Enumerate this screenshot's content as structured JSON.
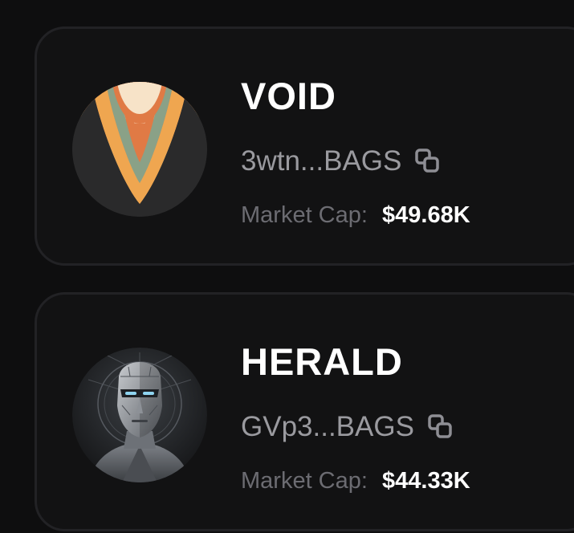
{
  "tokens": [
    {
      "name": "VOID",
      "address": "3wtn...BAGS",
      "market_cap_label": "Market Cap:",
      "market_cap_value": "$49.68K",
      "avatar_icon": "void-v-logo-icon"
    },
    {
      "name": "HERALD",
      "address": "GVp3...BAGS",
      "market_cap_label": "Market Cap:",
      "market_cap_value": "$44.33K",
      "avatar_icon": "herald-robot-head-icon"
    }
  ],
  "colors": {
    "background": "#0e0e0f",
    "card": "#121213",
    "card_border": "#222225",
    "text_primary": "#ffffff",
    "text_secondary": "#9a9a9f",
    "text_muted": "#6c6c72"
  },
  "icons": {
    "copy": "copy-icon"
  }
}
